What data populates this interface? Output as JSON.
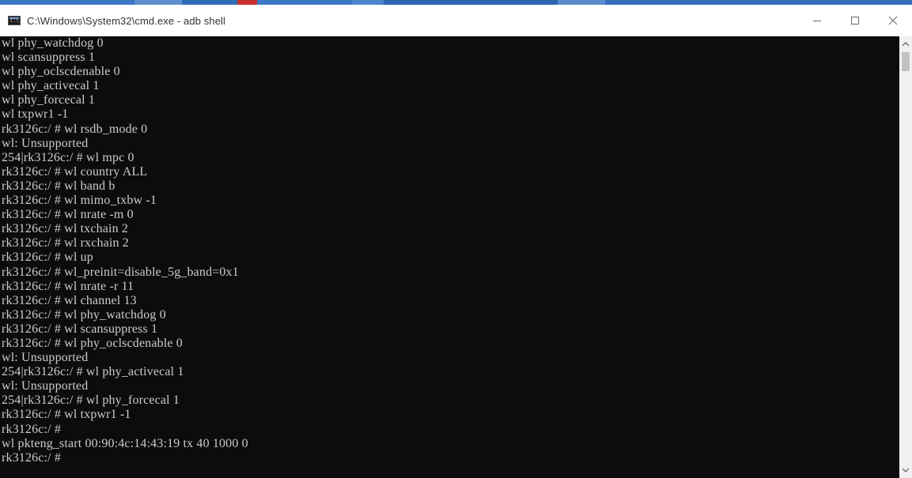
{
  "window": {
    "title": "C:\\Windows\\System32\\cmd.exe - adb  shell",
    "icon": "console-icon",
    "controls": [
      "minimize-icon",
      "maximize-icon",
      "close-icon"
    ]
  },
  "colors": {
    "console_bg": "#0c0c0c",
    "console_text": "#cccccc",
    "titlebar_bg": "#ffffff",
    "scrollbar_bg": "#f0f0f0",
    "scroll_thumb": "#c2c2c2"
  },
  "console": {
    "lines": [
      "wl phy_watchdog 0",
      "wl scansuppress 1",
      "wl phy_oclscdenable 0",
      "wl phy_activecal 1",
      "wl phy_forcecal 1",
      "wl txpwr1 -1",
      "rk3126c:/ # wl rsdb_mode 0",
      "wl: Unsupported",
      "254|rk3126c:/ # wl mpc 0",
      "rk3126c:/ # wl country ALL",
      "rk3126c:/ # wl band b",
      "rk3126c:/ # wl mimo_txbw -1",
      "rk3126c:/ # wl nrate -m 0",
      "rk3126c:/ # wl txchain 2",
      "rk3126c:/ # wl rxchain 2",
      "rk3126c:/ # wl up",
      "rk3126c:/ # wl_preinit=disable_5g_band=0x1",
      "rk3126c:/ # wl nrate -r 11",
      "rk3126c:/ # wl channel 13",
      "rk3126c:/ # wl phy_watchdog 0",
      "rk3126c:/ # wl scansuppress 1",
      "rk3126c:/ # wl phy_oclscdenable 0",
      "wl: Unsupported",
      "254|rk3126c:/ # wl phy_activecal 1",
      "wl: Unsupported",
      "254|rk3126c:/ # wl phy_forcecal 1",
      "rk3126c:/ # wl txpwr1 -1",
      "rk3126c:/ #",
      "wl pkteng_start 00:90:4c:14:43:19 tx 40 1000 0",
      "rk3126c:/ #"
    ]
  },
  "scrollbar": {
    "up_icon": "scroll-up-icon",
    "down_icon": "scroll-down-icon"
  }
}
